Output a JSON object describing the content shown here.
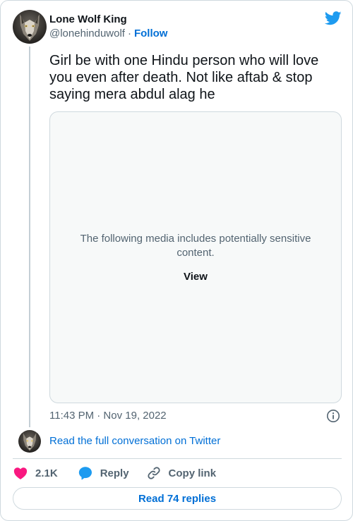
{
  "author": {
    "name": "Lone Wolf King",
    "handle": "@lonehinduwolf",
    "separator": "·",
    "follow_label": "Follow"
  },
  "tweet": {
    "text": "Girl be with one Hindu person who will love you even after death. Not like aftab & stop saying mera abdul alag he",
    "timestamp": "11:43 PM · Nov 19, 2022"
  },
  "media": {
    "warning": "The following media includes potentially sensitive content.",
    "view_label": "View"
  },
  "conversation": {
    "link_label": "Read the full conversation on Twitter"
  },
  "actions": {
    "like_count": "2.1K",
    "reply_label": "Reply",
    "copy_label": "Copy link"
  },
  "replies": {
    "button_label": "Read 74 replies"
  },
  "icons": {
    "logo": "twitter-bird-icon",
    "info": "info-icon",
    "like": "heart-icon",
    "reply": "speech-bubble-icon",
    "copy": "link-icon"
  },
  "colors": {
    "accent": "#1d9bf0",
    "link": "#006fd6",
    "like": "#f91880",
    "muted": "#536471",
    "border": "#cfd9de"
  }
}
